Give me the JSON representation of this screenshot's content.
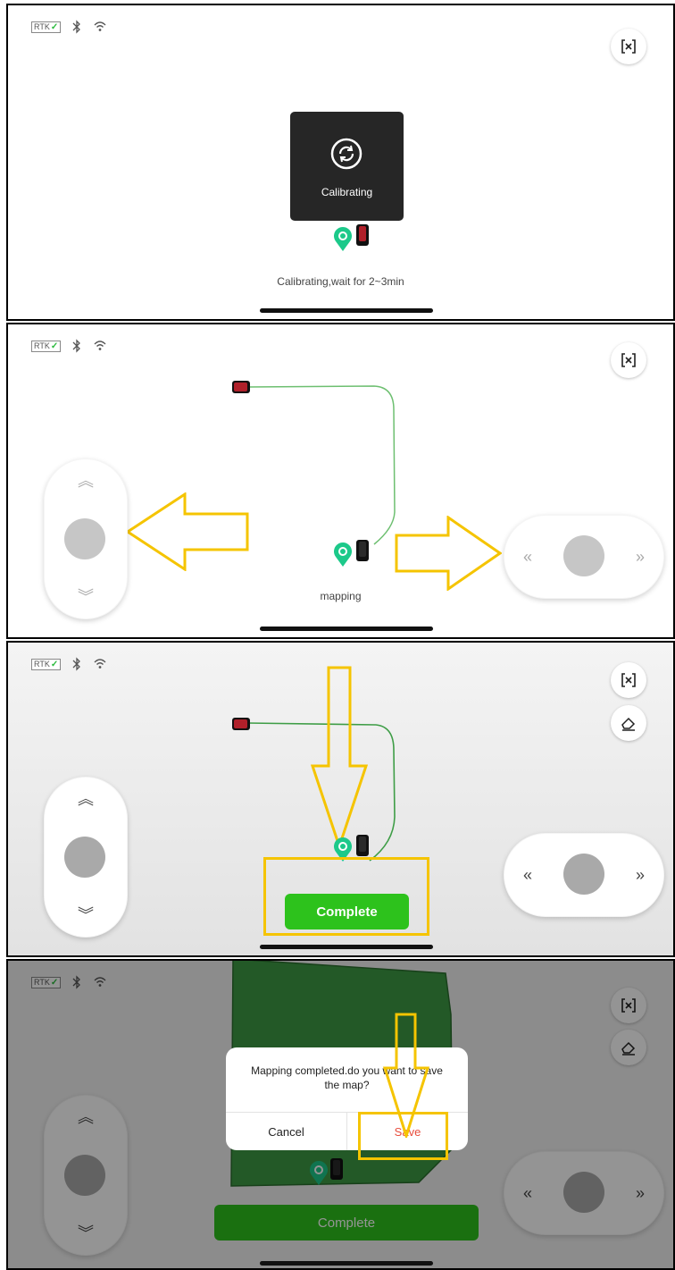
{
  "status_bar": {
    "rtk_label": "RTK",
    "rtk_check": "✓",
    "bluetooth_icon": "bluetooth-icon",
    "wifi_icon": "wifi-icon"
  },
  "icons": {
    "exit": "exit-mapping-icon",
    "eraser": "eraser-icon",
    "calibrate": "refresh-icon"
  },
  "controls": {
    "up_glyph": "︽",
    "down_glyph": "︾",
    "left_glyph": "«",
    "right_glyph": "»"
  },
  "panel1": {
    "toast_label": "Calibrating",
    "caption": "Calibrating,wait for 2~3min"
  },
  "panel2": {
    "caption": "mapping"
  },
  "panel3": {
    "complete_label": "Complete"
  },
  "panel4": {
    "dialog_message": "Mapping completed.do you want to save the map?",
    "cancel_label": "Cancel",
    "save_label": "Save",
    "complete_label": "Complete"
  },
  "colors": {
    "accent_green": "#2dc21c",
    "path_green": "#4aa34e",
    "marker_green": "#1cc98a",
    "highlight_yellow": "#f5c400",
    "save_red": "#e74c3c",
    "mower_red": "#b0202a"
  }
}
